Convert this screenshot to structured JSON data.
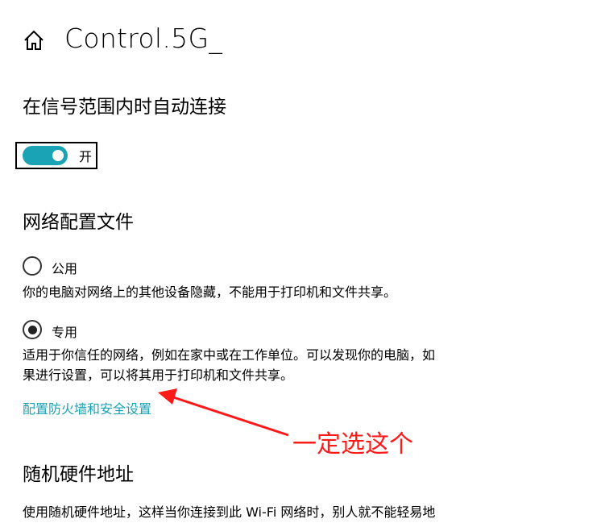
{
  "header": {
    "title": "Control.5G_",
    "home_icon": "home-icon"
  },
  "auto_connect": {
    "heading": "在信号范围内时自动连接",
    "toggle_state_label": "开",
    "toggle_on": true,
    "accent_color": "#1aa3b5"
  },
  "network_profile": {
    "heading": "网络配置文件",
    "options": [
      {
        "label": "公用",
        "selected": false,
        "description": "你的电脑对网络上的其他设备隐藏，不能用于打印机和文件共享。"
      },
      {
        "label": "专用",
        "selected": true,
        "description_line1": "适用于你信任的网络，例如在家中或在工作单位。可以发现你的电脑，如",
        "description_line2": "果进行设置，可以将其用于打印机和文件共享。"
      }
    ],
    "firewall_link": "配置防火墙和安全设置"
  },
  "annotation": {
    "text": "一定选这个",
    "color": "#ff1a1a"
  },
  "random_hw": {
    "heading": "随机硬件地址",
    "description_partial": "使用随机硬件地址，这样当你连接到此 Wi-Fi 网络时，别人就不能轻易地"
  }
}
